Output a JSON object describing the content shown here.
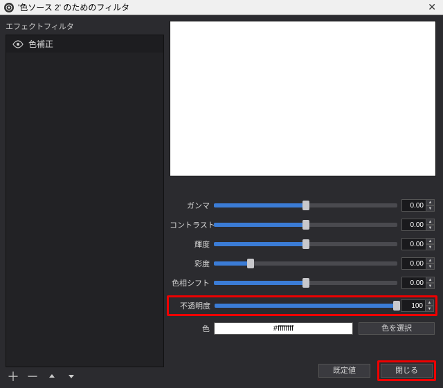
{
  "titlebar": {
    "title": "'色ソース 2' のためのフィルタ"
  },
  "left": {
    "header": "エフェクトフィルタ",
    "items": [
      {
        "label": "色補正"
      }
    ]
  },
  "controls": {
    "gamma": {
      "label": "ガンマ",
      "value": "0.00",
      "percent": 50
    },
    "contrast": {
      "label": "コントラスト",
      "value": "0.00",
      "percent": 50
    },
    "brightness": {
      "label": "輝度",
      "value": "0.00",
      "percent": 50
    },
    "saturation": {
      "label": "彩度",
      "value": "0.00",
      "percent": 20
    },
    "hue": {
      "label": "色相シフト",
      "value": "0.00",
      "percent": 50
    },
    "opacity": {
      "label": "不透明度",
      "value": "100",
      "percent": 100
    }
  },
  "color": {
    "label": "色",
    "value": "#ffffffff",
    "button": "色を選択"
  },
  "buttons": {
    "defaults": "既定値",
    "close": "閉じる"
  }
}
